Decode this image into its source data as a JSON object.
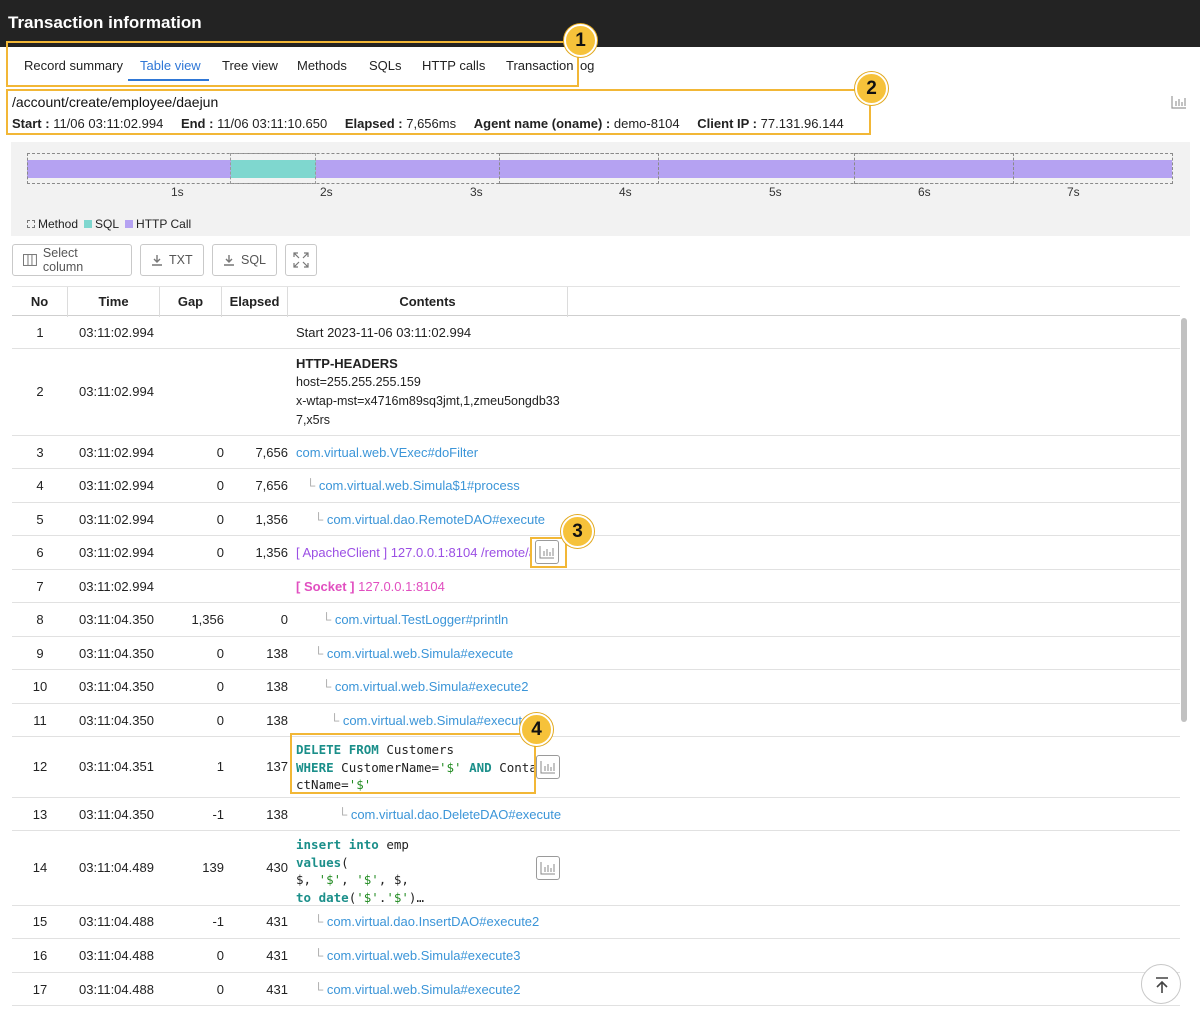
{
  "window": {
    "title": "Transaction information"
  },
  "tabs": [
    {
      "label": "Record summary"
    },
    {
      "label": "Table view"
    },
    {
      "label": "Tree view"
    },
    {
      "label": "Methods"
    },
    {
      "label": "SQLs"
    },
    {
      "label": "HTTP calls"
    },
    {
      "label": "Transaction log"
    }
  ],
  "active_tab": "Table view",
  "transaction": {
    "path": "/account/create/employee/daejun",
    "start_label": "Start :",
    "start": "11/06 03:11:02.994",
    "end_label": "End :",
    "end": "11/06 03:11:10.650",
    "elapsed_label": "Elapsed :",
    "elapsed": "7,656ms",
    "agent_label": "Agent name (oname) :",
    "agent": "demo-8104",
    "ip_label": "Client IP :",
    "ip": "77.131.96.144"
  },
  "timeline": {
    "ticks": [
      "1s",
      "2s",
      "3s",
      "4s",
      "5s",
      "6s",
      "7s"
    ],
    "legend": {
      "method": "Method",
      "sql": "SQL",
      "http": "HTTP Call"
    },
    "colors": {
      "sql": "#7fd7cf",
      "http": "#b5a2f2"
    }
  },
  "toolbar": {
    "select_column": "Select column",
    "txt": "TXT",
    "sql": "SQL"
  },
  "columns": [
    "No",
    "Time",
    "Gap",
    "Elapsed",
    "Contents"
  ],
  "rows": [
    {
      "no": "1",
      "time": "03:11:02.994",
      "gap": "",
      "elapsed": "",
      "content": "Start  2023-11-06 03:11:02.994"
    },
    {
      "no": "2",
      "time": "03:11:02.994",
      "gap": "",
      "elapsed": "",
      "content_title": "HTTP-HEADERS",
      "content_lines": [
        "host=255.255.255.159",
        "x-wtap-mst=x4716m89sq3jmt,1,zmeu5ongdb33",
        "7,x5rs"
      ]
    },
    {
      "no": "3",
      "time": "03:11:02.994",
      "gap": "0",
      "elapsed": "7,656",
      "content": "com.virtual.web.VExec#doFilter"
    },
    {
      "no": "4",
      "time": "03:11:02.994",
      "gap": "0",
      "elapsed": "7,656",
      "content": "com.virtual.web.Simula$1#process"
    },
    {
      "no": "5",
      "time": "03:11:02.994",
      "gap": "0",
      "elapsed": "1,356",
      "content": "com.virtual.dao.RemoteDAO#execute"
    },
    {
      "no": "6",
      "time": "03:11:02.994",
      "gap": "0",
      "elapsed": "1,356",
      "content_tag": "[ ApacheClient ]",
      "content": "127.0.0.1:8104 /remote/a..."
    },
    {
      "no": "7",
      "time": "03:11:02.994",
      "gap": "",
      "elapsed": "",
      "content_tag": "[ Socket ]",
      "content": "127.0.0.1:8104"
    },
    {
      "no": "8",
      "time": "03:11:04.350",
      "gap": "1,356",
      "elapsed": "0",
      "content": "com.virtual.TestLogger#println"
    },
    {
      "no": "9",
      "time": "03:11:04.350",
      "gap": "0",
      "elapsed": "138",
      "content": "com.virtual.web.Simula#execute"
    },
    {
      "no": "10",
      "time": "03:11:04.350",
      "gap": "0",
      "elapsed": "138",
      "content": "com.virtual.web.Simula#execute2"
    },
    {
      "no": "11",
      "time": "03:11:04.350",
      "gap": "0",
      "elapsed": "138",
      "content": "com.virtual.web.Simula#execute3"
    },
    {
      "no": "12",
      "time": "03:11:04.351",
      "gap": "1",
      "elapsed": "137",
      "sql": {
        "kw1": "DELETE",
        "kw2": "FROM",
        "t1": " Customers",
        "kw3": "WHERE",
        "t2": " CustomerName=",
        "s1": "'$'",
        "kw4": "AND",
        "t3": " Conta",
        "t4": "ctName=",
        "s2": "'$'"
      }
    },
    {
      "no": "13",
      "time": "03:11:04.350",
      "gap": "-1",
      "elapsed": "138",
      "content": "com.virtual.dao.DeleteDAO#execute"
    },
    {
      "no": "14",
      "time": "03:11:04.489",
      "gap": "139",
      "elapsed": "430",
      "sql": {
        "kw1": "insert",
        "kw2": "into",
        "t1": " emp",
        "kw3": "values",
        "t2": "(",
        "l3a": "$, ",
        "s1": "'$'",
        "l3b": ", ",
        "s2": "'$'",
        "l3c": ", $,",
        "kw4": "to",
        "kw5": "date",
        "l4a": "(",
        "s3": "'$'",
        "l4b": ".",
        "s4": "'$'",
        "l4c": ")…"
      }
    },
    {
      "no": "15",
      "time": "03:11:04.488",
      "gap": "-1",
      "elapsed": "431",
      "content": "com.virtual.dao.InsertDAO#execute2"
    },
    {
      "no": "16",
      "time": "03:11:04.488",
      "gap": "0",
      "elapsed": "431",
      "content": "com.virtual.web.Simula#execute3"
    },
    {
      "no": "17",
      "time": "03:11:04.488",
      "gap": "0",
      "elapsed": "431",
      "content": "com.virtual.web.Simula#execute2"
    }
  ],
  "callouts": [
    "1",
    "2",
    "3",
    "4"
  ]
}
